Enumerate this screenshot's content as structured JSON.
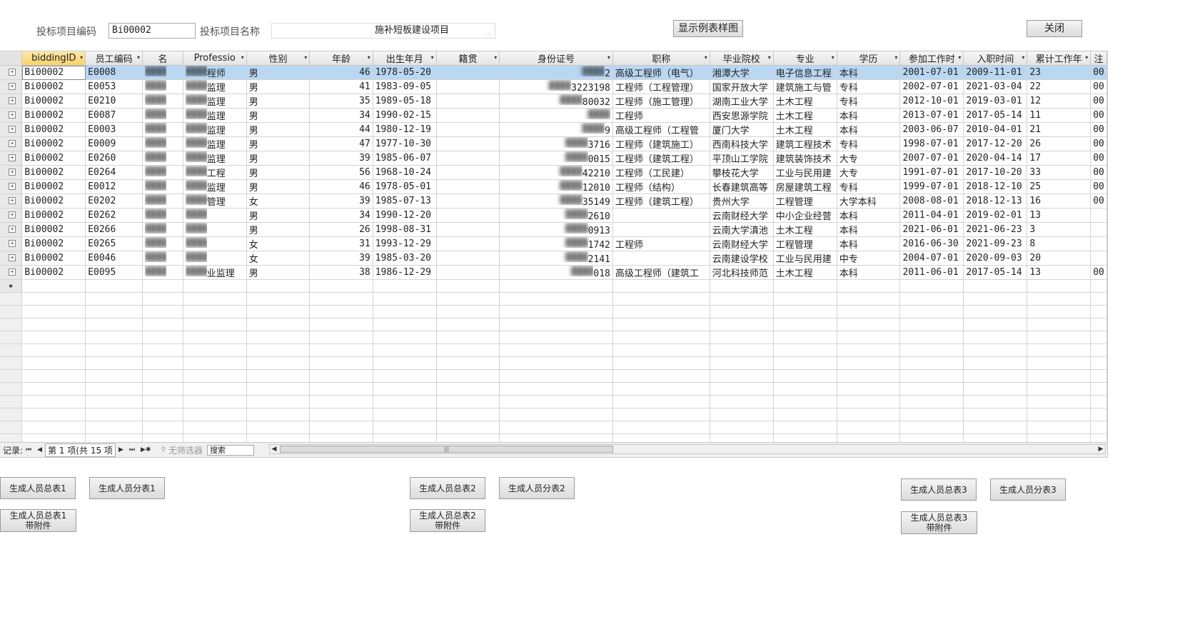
{
  "header": {
    "project_code_label": "投标项目编码",
    "project_code_value": "Bi00002",
    "project_name_label": "投标项目名称",
    "project_name_value": "施补短板建设项目",
    "show_sample_button": "显示例表样图",
    "close_button": "关闭"
  },
  "grid": {
    "columns": [
      {
        "label": "biddingID",
        "filter": true
      },
      {
        "label": "员工编码",
        "filter": true
      },
      {
        "label": "名",
        "filter": false
      },
      {
        "label": "Professio",
        "filter": true
      },
      {
        "label": "性别",
        "filter": true
      },
      {
        "label": "年龄",
        "filter": true
      },
      {
        "label": "出生年月",
        "filter": true
      },
      {
        "label": "籍贯",
        "filter": true
      },
      {
        "label": "身份证号",
        "filter": true
      },
      {
        "label": "职称",
        "filter": true
      },
      {
        "label": "毕业院校",
        "filter": true
      },
      {
        "label": "专业",
        "filter": true
      },
      {
        "label": "学历",
        "filter": true
      },
      {
        "label": "参加工作时",
        "filter": true
      },
      {
        "label": "入职时间",
        "filter": true
      },
      {
        "label": "累计工作年",
        "filter": true
      },
      {
        "label": "注",
        "filter": false
      }
    ],
    "rows": [
      [
        "Bi00002",
        "E0008",
        "",
        "程师",
        "男",
        "46",
        "1978-05-20",
        "",
        "2",
        "高级工程师（电气）",
        "湘潭大学",
        "电子信息工程",
        "本科",
        "2001-07-01",
        "2009-11-01",
        "23",
        "00"
      ],
      [
        "Bi00002",
        "E0053",
        "",
        "监理",
        "男",
        "41",
        "1983-09-05",
        "",
        "3223198",
        "工程师（工程管理）",
        "国家开放大学",
        "建筑施工与管",
        "专科",
        "2002-07-01",
        "2021-03-04",
        "22",
        "00"
      ],
      [
        "Bi00002",
        "E0210",
        "",
        "监理",
        "男",
        "35",
        "1989-05-18",
        "",
        "80032",
        "工程师（施工管理）",
        "湖南工业大学",
        "土木工程",
        "专科",
        "2012-10-01",
        "2019-03-01",
        "12",
        "00"
      ],
      [
        "Bi00002",
        "E0087",
        "",
        "监理",
        "男",
        "34",
        "1990-02-15",
        "",
        "",
        "工程师",
        "西安思源学院",
        "土木工程",
        "本科",
        "2013-07-01",
        "2017-05-14",
        "11",
        "00"
      ],
      [
        "Bi00002",
        "E0003",
        "",
        "监理",
        "男",
        "44",
        "1980-12-19",
        "",
        "9",
        "高级工程师（工程管",
        "厦门大学",
        "土木工程",
        "本科",
        "2003-06-07",
        "2010-04-01",
        "21",
        "00"
      ],
      [
        "Bi00002",
        "E0009",
        "",
        "监理",
        "男",
        "47",
        "1977-10-30",
        "",
        "3716",
        "工程师（建筑施工）",
        "西南科技大学",
        "建筑工程技术",
        "专科",
        "1998-07-01",
        "2017-12-20",
        "26",
        "00"
      ],
      [
        "Bi00002",
        "E0260",
        "",
        "监理",
        "男",
        "39",
        "1985-06-07",
        "",
        "0015",
        "工程师（建筑工程）",
        "平顶山工学院",
        "建筑装饰技术",
        "大专",
        "2007-07-01",
        "2020-04-14",
        "17",
        "00"
      ],
      [
        "Bi00002",
        "E0264",
        "",
        "工程",
        "男",
        "56",
        "1968-10-24",
        "",
        "42210",
        "工程师（工民建）",
        "攀枝花大学",
        "工业与民用建",
        "大专",
        "1991-07-01",
        "2017-10-20",
        "33",
        "00"
      ],
      [
        "Bi00002",
        "E0012",
        "",
        "监理",
        "男",
        "46",
        "1978-05-01",
        "",
        "12010",
        "工程师（结构）",
        "长春建筑高等",
        "房屋建筑工程",
        "专科",
        "1999-07-01",
        "2018-12-10",
        "25",
        "00"
      ],
      [
        "Bi00002",
        "E0202",
        "",
        "管理",
        "女",
        "39",
        "1985-07-13",
        "",
        "35149",
        "工程师（建筑工程）",
        "贵州大学",
        "工程管理",
        "大学本科",
        "2008-08-01",
        "2018-12-13",
        "16",
        "00"
      ],
      [
        "Bi00002",
        "E0262",
        "",
        "",
        "男",
        "34",
        "1990-12-20",
        "",
        "2610",
        "",
        "云南财经大学",
        "中小企业经营",
        "本科",
        "2011-04-01",
        "2019-02-01",
        "13",
        ""
      ],
      [
        "Bi00002",
        "E0266",
        "",
        "",
        "男",
        "26",
        "1998-08-31",
        "",
        "0913",
        "",
        "云南大学滇池",
        "土木工程",
        "本科",
        "2021-06-01",
        "2021-06-23",
        "3",
        ""
      ],
      [
        "Bi00002",
        "E0265",
        "",
        "",
        "女",
        "31",
        "1993-12-29",
        "",
        "1742",
        "工程师",
        "云南财经大学",
        "工程管理",
        "本科",
        "2016-06-30",
        "2021-09-23",
        "8",
        ""
      ],
      [
        "Bi00002",
        "E0046",
        "",
        "",
        "女",
        "39",
        "1985-03-20",
        "",
        "2141",
        "",
        "云南建设学校",
        "工业与民用建",
        "中专",
        "2004-07-01",
        "2020-09-03",
        "20",
        ""
      ],
      [
        "Bi00002",
        "E0095",
        "",
        "业监理",
        "男",
        "38",
        "1986-12-29",
        "",
        "018",
        "高级工程师（建筑工",
        "河北科技师范",
        "土木工程",
        "本科",
        "2011-06-01",
        "2017-05-14",
        "13",
        "00"
      ]
    ]
  },
  "navbar": {
    "record_label": "记录:",
    "position_text": "第 1 项(共 15 项",
    "filter_text": "无筛选器",
    "search_placeholder": "搜索"
  },
  "buttons": {
    "gen_total_1": "生成人员总表1",
    "gen_sub_1": "生成人员分表1",
    "gen_total_1_att": "生成人员总表1带附件",
    "gen_total_2": "生成人员总表2",
    "gen_sub_2": "生成人员分表2",
    "gen_total_2_att": "生成人员总表2带附件",
    "gen_total_3": "生成人员总表3",
    "gen_sub_3": "生成人员分表3",
    "gen_total_3_att": "生成人员总表3带附件"
  }
}
